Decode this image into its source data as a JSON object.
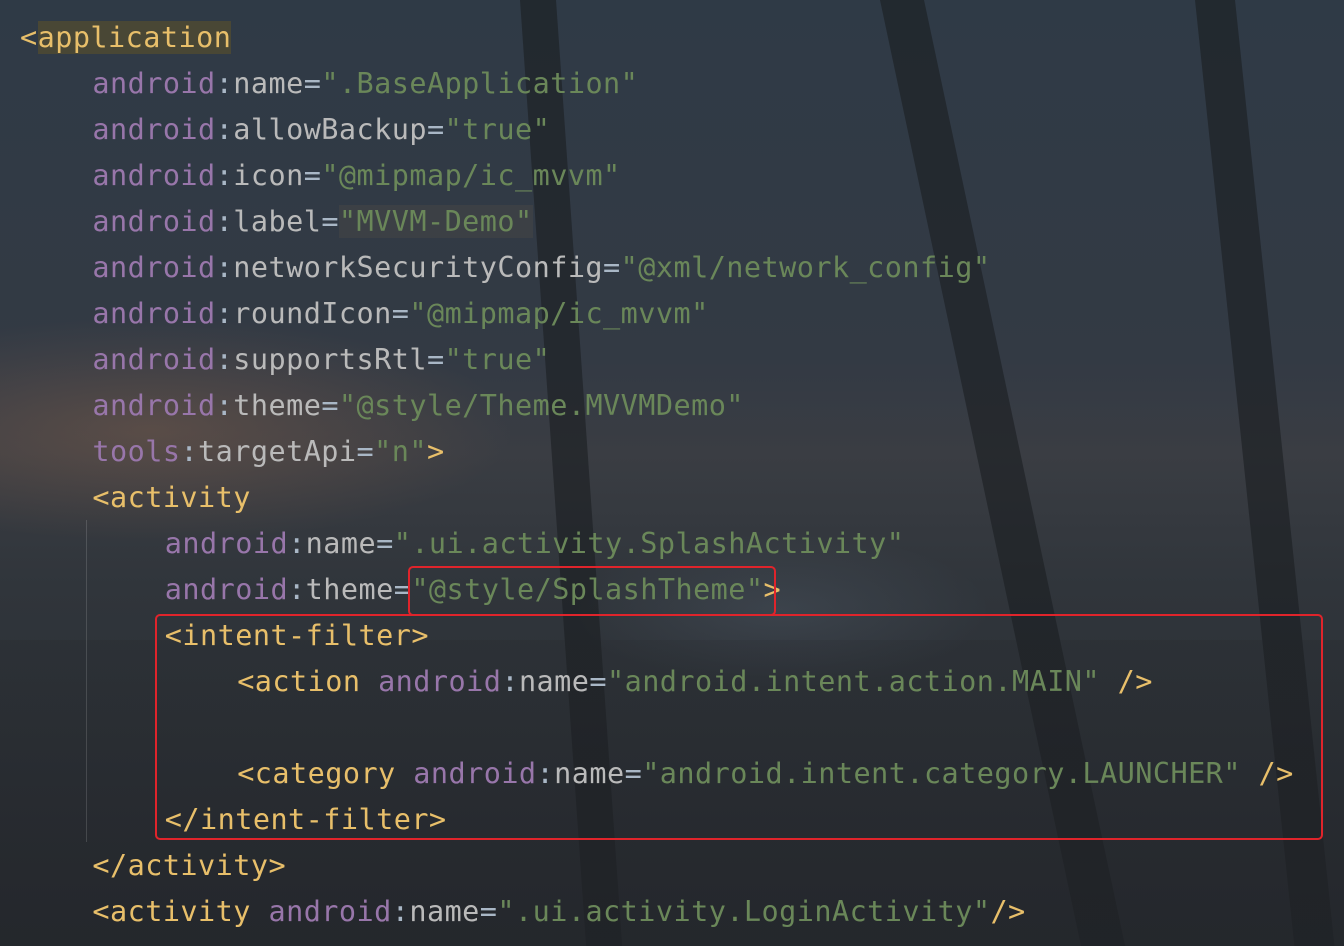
{
  "editor": {
    "language": "xml",
    "lines": [
      {
        "indent": 0,
        "tokens": [
          {
            "t": "<",
            "c": "tag"
          },
          {
            "t": "application",
            "c": "tag",
            "hl": "tag"
          }
        ]
      },
      {
        "indent": 4,
        "tokens": [
          {
            "t": "android",
            "c": "ns"
          },
          {
            "t": ":",
            "c": "eq"
          },
          {
            "t": "name",
            "c": "attr"
          },
          {
            "t": "=",
            "c": "eq"
          },
          {
            "t": "\".BaseApplication\"",
            "c": "val"
          }
        ]
      },
      {
        "indent": 4,
        "tokens": [
          {
            "t": "android",
            "c": "ns"
          },
          {
            "t": ":",
            "c": "eq"
          },
          {
            "t": "allowBackup",
            "c": "attr"
          },
          {
            "t": "=",
            "c": "eq"
          },
          {
            "t": "\"true\"",
            "c": "val"
          }
        ]
      },
      {
        "indent": 4,
        "tokens": [
          {
            "t": "android",
            "c": "ns"
          },
          {
            "t": ":",
            "c": "eq"
          },
          {
            "t": "icon",
            "c": "attr"
          },
          {
            "t": "=",
            "c": "eq"
          },
          {
            "t": "\"@mipmap/ic_mvvm\"",
            "c": "val"
          }
        ]
      },
      {
        "indent": 4,
        "tokens": [
          {
            "t": "android",
            "c": "ns"
          },
          {
            "t": ":",
            "c": "eq"
          },
          {
            "t": "label",
            "c": "attr"
          },
          {
            "t": "=",
            "c": "eq"
          },
          {
            "t": "\"MVVM-Demo\"",
            "c": "val",
            "hl": "val"
          }
        ]
      },
      {
        "indent": 4,
        "tokens": [
          {
            "t": "android",
            "c": "ns"
          },
          {
            "t": ":",
            "c": "eq"
          },
          {
            "t": "networkSecurityConfig",
            "c": "attr"
          },
          {
            "t": "=",
            "c": "eq"
          },
          {
            "t": "\"@xml/network_config\"",
            "c": "val"
          }
        ]
      },
      {
        "indent": 4,
        "tokens": [
          {
            "t": "android",
            "c": "ns"
          },
          {
            "t": ":",
            "c": "eq"
          },
          {
            "t": "roundIcon",
            "c": "attr"
          },
          {
            "t": "=",
            "c": "eq"
          },
          {
            "t": "\"@mipmap/ic_mvvm\"",
            "c": "val"
          }
        ]
      },
      {
        "indent": 4,
        "tokens": [
          {
            "t": "android",
            "c": "ns"
          },
          {
            "t": ":",
            "c": "eq"
          },
          {
            "t": "supportsRtl",
            "c": "attr"
          },
          {
            "t": "=",
            "c": "eq"
          },
          {
            "t": "\"true\"",
            "c": "val"
          }
        ]
      },
      {
        "indent": 4,
        "tokens": [
          {
            "t": "android",
            "c": "ns"
          },
          {
            "t": ":",
            "c": "eq"
          },
          {
            "t": "theme",
            "c": "attr"
          },
          {
            "t": "=",
            "c": "eq"
          },
          {
            "t": "\"@style/Theme.MVVMDemo\"",
            "c": "val"
          }
        ]
      },
      {
        "indent": 4,
        "tokens": [
          {
            "t": "tools",
            "c": "ns"
          },
          {
            "t": ":",
            "c": "eq"
          },
          {
            "t": "targetApi",
            "c": "attr"
          },
          {
            "t": "=",
            "c": "eq"
          },
          {
            "t": "\"n\"",
            "c": "val"
          },
          {
            "t": ">",
            "c": "tag"
          }
        ]
      },
      {
        "indent": 4,
        "tokens": [
          {
            "t": "<activity",
            "c": "tag"
          }
        ]
      },
      {
        "indent": 8,
        "tokens": [
          {
            "t": "android",
            "c": "ns"
          },
          {
            "t": ":",
            "c": "eq"
          },
          {
            "t": "name",
            "c": "attr"
          },
          {
            "t": "=",
            "c": "eq"
          },
          {
            "t": "\".ui.activity.SplashActivity\"",
            "c": "val"
          }
        ]
      },
      {
        "indent": 8,
        "tokens": [
          {
            "t": "android",
            "c": "ns"
          },
          {
            "t": ":",
            "c": "eq"
          },
          {
            "t": "theme",
            "c": "attr"
          },
          {
            "t": "=",
            "c": "eq"
          },
          {
            "t": "\"@style/SplashTheme\"",
            "c": "val"
          },
          {
            "t": ">",
            "c": "tag"
          }
        ]
      },
      {
        "indent": 8,
        "tokens": [
          {
            "t": "<intent-filter>",
            "c": "tag"
          }
        ]
      },
      {
        "indent": 12,
        "tokens": [
          {
            "t": "<action ",
            "c": "tag"
          },
          {
            "t": "android",
            "c": "ns"
          },
          {
            "t": ":",
            "c": "eq"
          },
          {
            "t": "name",
            "c": "attr"
          },
          {
            "t": "=",
            "c": "eq"
          },
          {
            "t": "\"android.intent.action.MAIN\"",
            "c": "val"
          },
          {
            "t": " />",
            "c": "tag"
          }
        ]
      },
      {
        "indent": 0,
        "tokens": []
      },
      {
        "indent": 12,
        "tokens": [
          {
            "t": "<category ",
            "c": "tag"
          },
          {
            "t": "android",
            "c": "ns"
          },
          {
            "t": ":",
            "c": "eq"
          },
          {
            "t": "name",
            "c": "attr"
          },
          {
            "t": "=",
            "c": "eq"
          },
          {
            "t": "\"android.intent.category.LAUNCHER\"",
            "c": "val"
          },
          {
            "t": " />",
            "c": "tag"
          }
        ]
      },
      {
        "indent": 8,
        "tokens": [
          {
            "t": "</intent-filter>",
            "c": "tag"
          }
        ]
      },
      {
        "indent": 4,
        "tokens": [
          {
            "t": "</activity>",
            "c": "tag"
          }
        ]
      },
      {
        "indent": 4,
        "tokens": [
          {
            "t": "<activity ",
            "c": "tag"
          },
          {
            "t": "android",
            "c": "ns"
          },
          {
            "t": ":",
            "c": "eq"
          },
          {
            "t": "name",
            "c": "attr"
          },
          {
            "t": "=",
            "c": "eq"
          },
          {
            "t": "\".ui.activity.LoginActivity\"",
            "c": "val"
          },
          {
            "t": "/>",
            "c": "tag"
          }
        ]
      }
    ]
  },
  "colors": {
    "tag": "#e8bf6a",
    "namespace": "#9876aa",
    "attribute": "#bababa",
    "string": "#6a8759",
    "plain": "#a9b7c6",
    "annotation_box": "#e0242b"
  }
}
